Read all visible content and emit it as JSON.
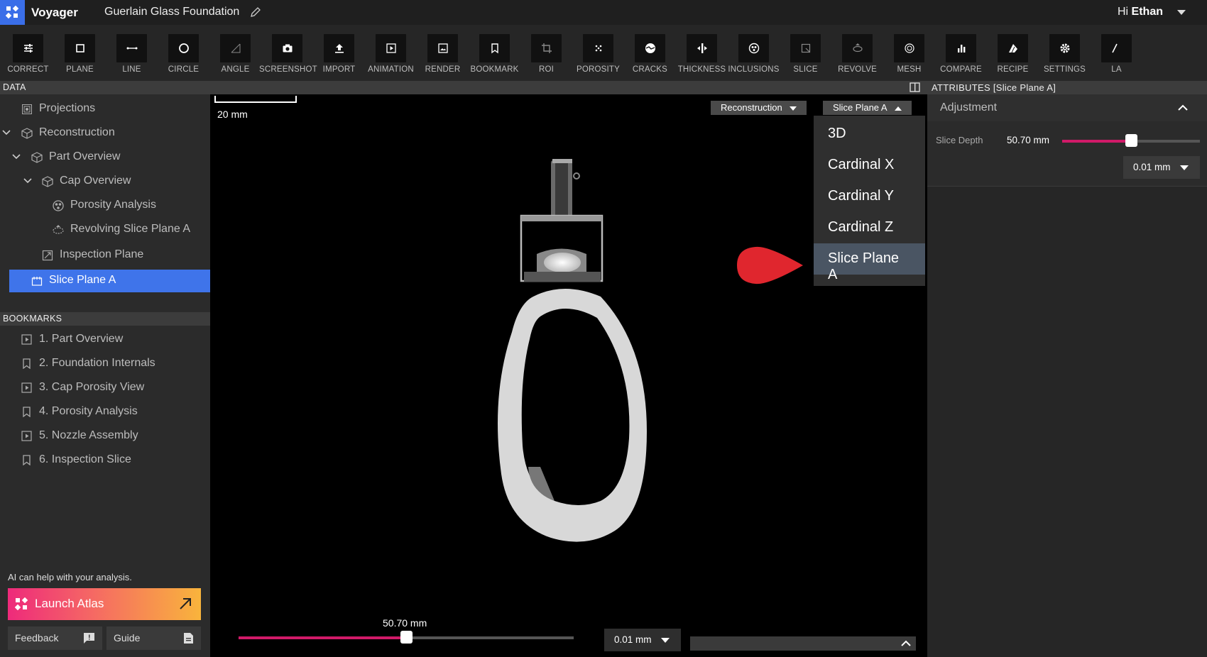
{
  "app": {
    "name": "Voyager",
    "document_title": "Guerlain Glass Foundation",
    "greeting": "Hi",
    "user": "Ethan"
  },
  "toolbar": [
    {
      "label": "CORRECT",
      "icon": "sliders-icon"
    },
    {
      "label": "PLANE",
      "icon": "square-icon"
    },
    {
      "label": "LINE",
      "icon": "line-icon"
    },
    {
      "label": "CIRCLE",
      "icon": "circle-icon"
    },
    {
      "label": "ANGLE",
      "icon": "angle-icon"
    },
    {
      "label": "SCREENSHOT",
      "icon": "camera-icon"
    },
    {
      "label": "IMPORT",
      "icon": "upload-icon"
    },
    {
      "label": "ANIMATION",
      "icon": "play-icon"
    },
    {
      "label": "RENDER",
      "icon": "image-icon"
    },
    {
      "label": "BOOKMARK",
      "icon": "bookmark-icon"
    },
    {
      "label": "ROI",
      "icon": "crop-icon"
    },
    {
      "label": "POROSITY",
      "icon": "dots-icon"
    },
    {
      "label": "CRACKS",
      "icon": "cracks-icon"
    },
    {
      "label": "THICKNESS",
      "icon": "thickness-icon"
    },
    {
      "label": "INCLUSIONS",
      "icon": "inclusions-icon"
    },
    {
      "label": "SLICE",
      "icon": "slice-icon"
    },
    {
      "label": "REVOLVE",
      "icon": "revolve-icon"
    },
    {
      "label": "MESH",
      "icon": "mesh-icon"
    },
    {
      "label": "COMPARE",
      "icon": "bar-chart-icon"
    },
    {
      "label": "RECIPE",
      "icon": "recipe-icon"
    },
    {
      "label": "SETTINGS",
      "icon": "gear-icon"
    },
    {
      "label": "LA",
      "icon": "partial-icon"
    }
  ],
  "data_panel": {
    "header": "DATA",
    "items": [
      {
        "label": "Projections",
        "icon": "projections-icon"
      },
      {
        "label": "Reconstruction",
        "icon": "cube-icon"
      },
      {
        "label": "Part Overview",
        "icon": "cube-icon"
      },
      {
        "label": "Cap Overview",
        "icon": "cube-icon"
      },
      {
        "label": "Porosity Analysis",
        "icon": "porosity-icon"
      },
      {
        "label": "Revolving Slice Plane A",
        "icon": "revolve-icon"
      },
      {
        "label": "Inspection Plane",
        "icon": "plane-icon"
      },
      {
        "label": "Slice Plane A",
        "icon": "slice-plane-icon"
      }
    ]
  },
  "bookmarks_panel": {
    "header": "BOOKMARKS",
    "items": [
      {
        "label": "1. Part Overview",
        "icon": "play-square-icon"
      },
      {
        "label": "2. Foundation Internals",
        "icon": "bookmark-icon"
      },
      {
        "label": "3. Cap Porosity View",
        "icon": "play-square-icon"
      },
      {
        "label": "4. Porosity Analysis",
        "icon": "bookmark-icon"
      },
      {
        "label": "5. Nozzle Assembly",
        "icon": "play-square-icon"
      },
      {
        "label": "6. Inspection Slice",
        "icon": "bookmark-icon"
      }
    ]
  },
  "atlas": {
    "help_text": "AI can help with your analysis.",
    "button": "Launch Atlas"
  },
  "footer": {
    "feedback": "Feedback",
    "guide": "Guide"
  },
  "viewport": {
    "scale_label": "20 mm",
    "view_dropdown": "Reconstruction",
    "plane_dropdown": "Slice Plane A",
    "plane_menu": [
      "3D",
      "Cardinal X",
      "Cardinal Y",
      "Cardinal Z",
      "Slice Plane A"
    ],
    "slider_value": "50.70 mm",
    "slider_fraction": 0.5,
    "step": "0.01 mm"
  },
  "attributes": {
    "header": "ATTRIBUTES [Slice Plane A]",
    "section": "Adjustment",
    "slice_depth_label": "Slice Depth",
    "slice_depth_value": "50.70 mm",
    "slice_depth_fraction": 0.5,
    "step": "0.01 mm"
  },
  "colors": {
    "accent": "#3f74ea",
    "slider": "#d01a68",
    "pointer": "#e0262e"
  }
}
